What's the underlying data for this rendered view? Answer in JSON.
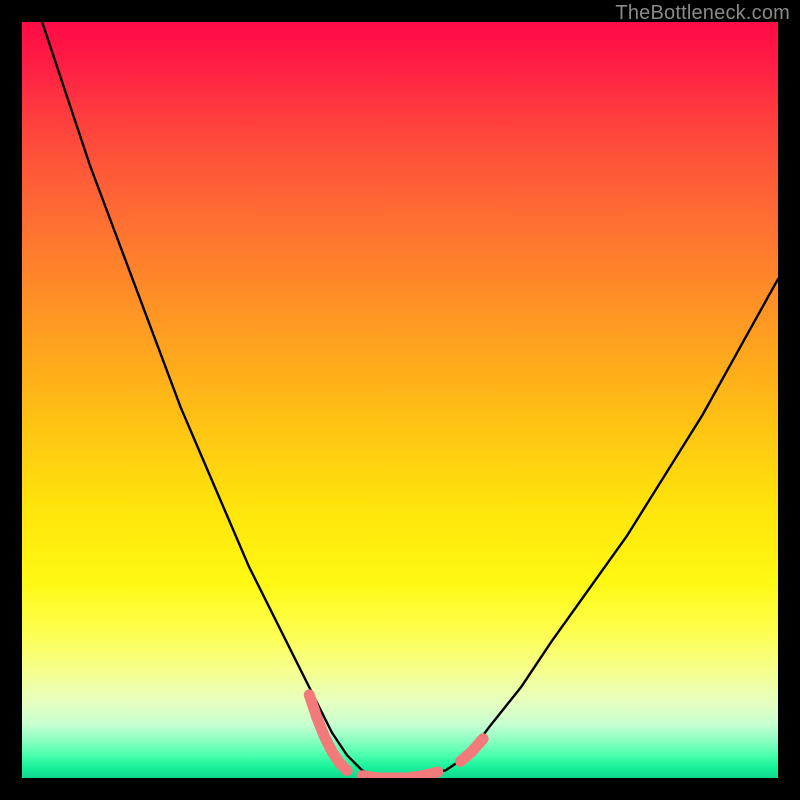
{
  "watermark": {
    "text": "TheBottleneck.com"
  },
  "colors": {
    "background": "#000000",
    "curve_stroke": "#000000",
    "accent_stroke": "#f27a7a",
    "gradient_top": "#ff0b46",
    "gradient_bottom": "#0fd88e"
  },
  "chart_data": {
    "type": "line",
    "title": "",
    "xlabel": "",
    "ylabel": "",
    "xlim": [
      0,
      100
    ],
    "ylim": [
      0,
      100
    ],
    "grid": false,
    "legend": false,
    "note": "Axes are percentage-like normalized units; no tick labels shown in image.",
    "series": [
      {
        "name": "bottleneck-curve",
        "x": [
          0,
          3,
          6,
          9,
          12,
          15,
          18,
          21,
          24,
          27,
          30,
          33,
          36,
          39,
          41,
          43,
          45,
          47,
          50,
          53,
          56,
          59,
          62,
          66,
          70,
          75,
          80,
          85,
          90,
          95,
          100
        ],
        "y": [
          108,
          99,
          90,
          81,
          73,
          65,
          57,
          49,
          42,
          35,
          28,
          22,
          16,
          10,
          6,
          3,
          1,
          0,
          0,
          0.5,
          1,
          3,
          7,
          12,
          18,
          25,
          32,
          40,
          48,
          57,
          66
        ]
      }
    ],
    "accent_segments": [
      {
        "name": "left-accent",
        "x": [
          38,
          39,
          40,
          41,
          42,
          43
        ],
        "y": [
          11,
          8,
          5.5,
          3.5,
          2,
          1
        ]
      },
      {
        "name": "floor-accent",
        "x": [
          45,
          47,
          49,
          51,
          53,
          55
        ],
        "y": [
          0.3,
          0,
          0,
          0,
          0.3,
          0.8
        ]
      },
      {
        "name": "right-accent",
        "x": [
          58,
          59.5,
          61
        ],
        "y": [
          2.2,
          3.5,
          5.2
        ]
      }
    ]
  }
}
